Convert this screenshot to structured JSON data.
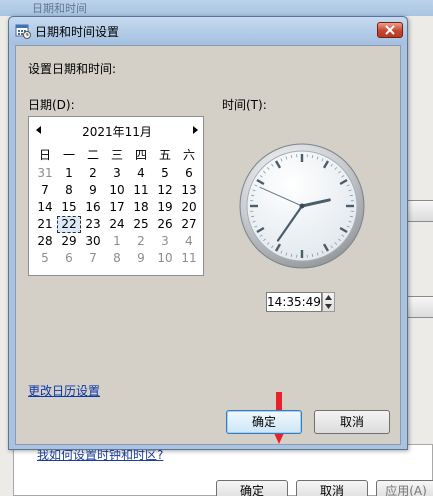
{
  "background_window": {
    "title": "日期和时间",
    "link": "我如何设置时钟和时区?",
    "ok": "确定",
    "cancel": "取消",
    "apply": "应用(A)"
  },
  "dialog": {
    "title": "日期和时间设置",
    "heading": "设置日期和时间:",
    "date_label": "日期(D):",
    "time_label": "时间(T):",
    "change_calendar_link": "更改日历设置",
    "ok_label": "确定",
    "cancel_label": "取消"
  },
  "calendar": {
    "month_label": "2021年11月",
    "weekdays": [
      "日",
      "一",
      "二",
      "三",
      "四",
      "五",
      "六"
    ],
    "selected_day": "22",
    "days": [
      {
        "d": "31",
        "other": true
      },
      {
        "d": "1"
      },
      {
        "d": "2"
      },
      {
        "d": "3"
      },
      {
        "d": "4"
      },
      {
        "d": "5"
      },
      {
        "d": "6"
      },
      {
        "d": "7"
      },
      {
        "d": "8"
      },
      {
        "d": "9"
      },
      {
        "d": "10"
      },
      {
        "d": "11"
      },
      {
        "d": "12"
      },
      {
        "d": "13"
      },
      {
        "d": "14"
      },
      {
        "d": "15"
      },
      {
        "d": "16"
      },
      {
        "d": "17"
      },
      {
        "d": "18"
      },
      {
        "d": "19"
      },
      {
        "d": "20"
      },
      {
        "d": "21"
      },
      {
        "d": "22"
      },
      {
        "d": "23"
      },
      {
        "d": "24"
      },
      {
        "d": "25"
      },
      {
        "d": "26"
      },
      {
        "d": "27"
      },
      {
        "d": "28"
      },
      {
        "d": "29"
      },
      {
        "d": "30"
      },
      {
        "d": "1",
        "other": true
      },
      {
        "d": "2",
        "other": true
      },
      {
        "d": "3",
        "other": true
      },
      {
        "d": "4",
        "other": true
      },
      {
        "d": "5",
        "other": true
      },
      {
        "d": "6",
        "other": true
      },
      {
        "d": "7",
        "other": true
      },
      {
        "d": "8",
        "other": true
      },
      {
        "d": "9",
        "other": true
      },
      {
        "d": "10",
        "other": true
      },
      {
        "d": "11",
        "other": true
      }
    ]
  },
  "clock": {
    "time_text": "14:35:49",
    "hour": 14,
    "minute": 35,
    "second": 49
  },
  "colors": {
    "annotation_arrow": "#e8202a",
    "link": "#0a37a8"
  },
  "icons": {
    "title": "calendar-clock-icon",
    "close": "close-icon",
    "prev": "chevron-left-icon",
    "next": "chevron-right-icon"
  }
}
